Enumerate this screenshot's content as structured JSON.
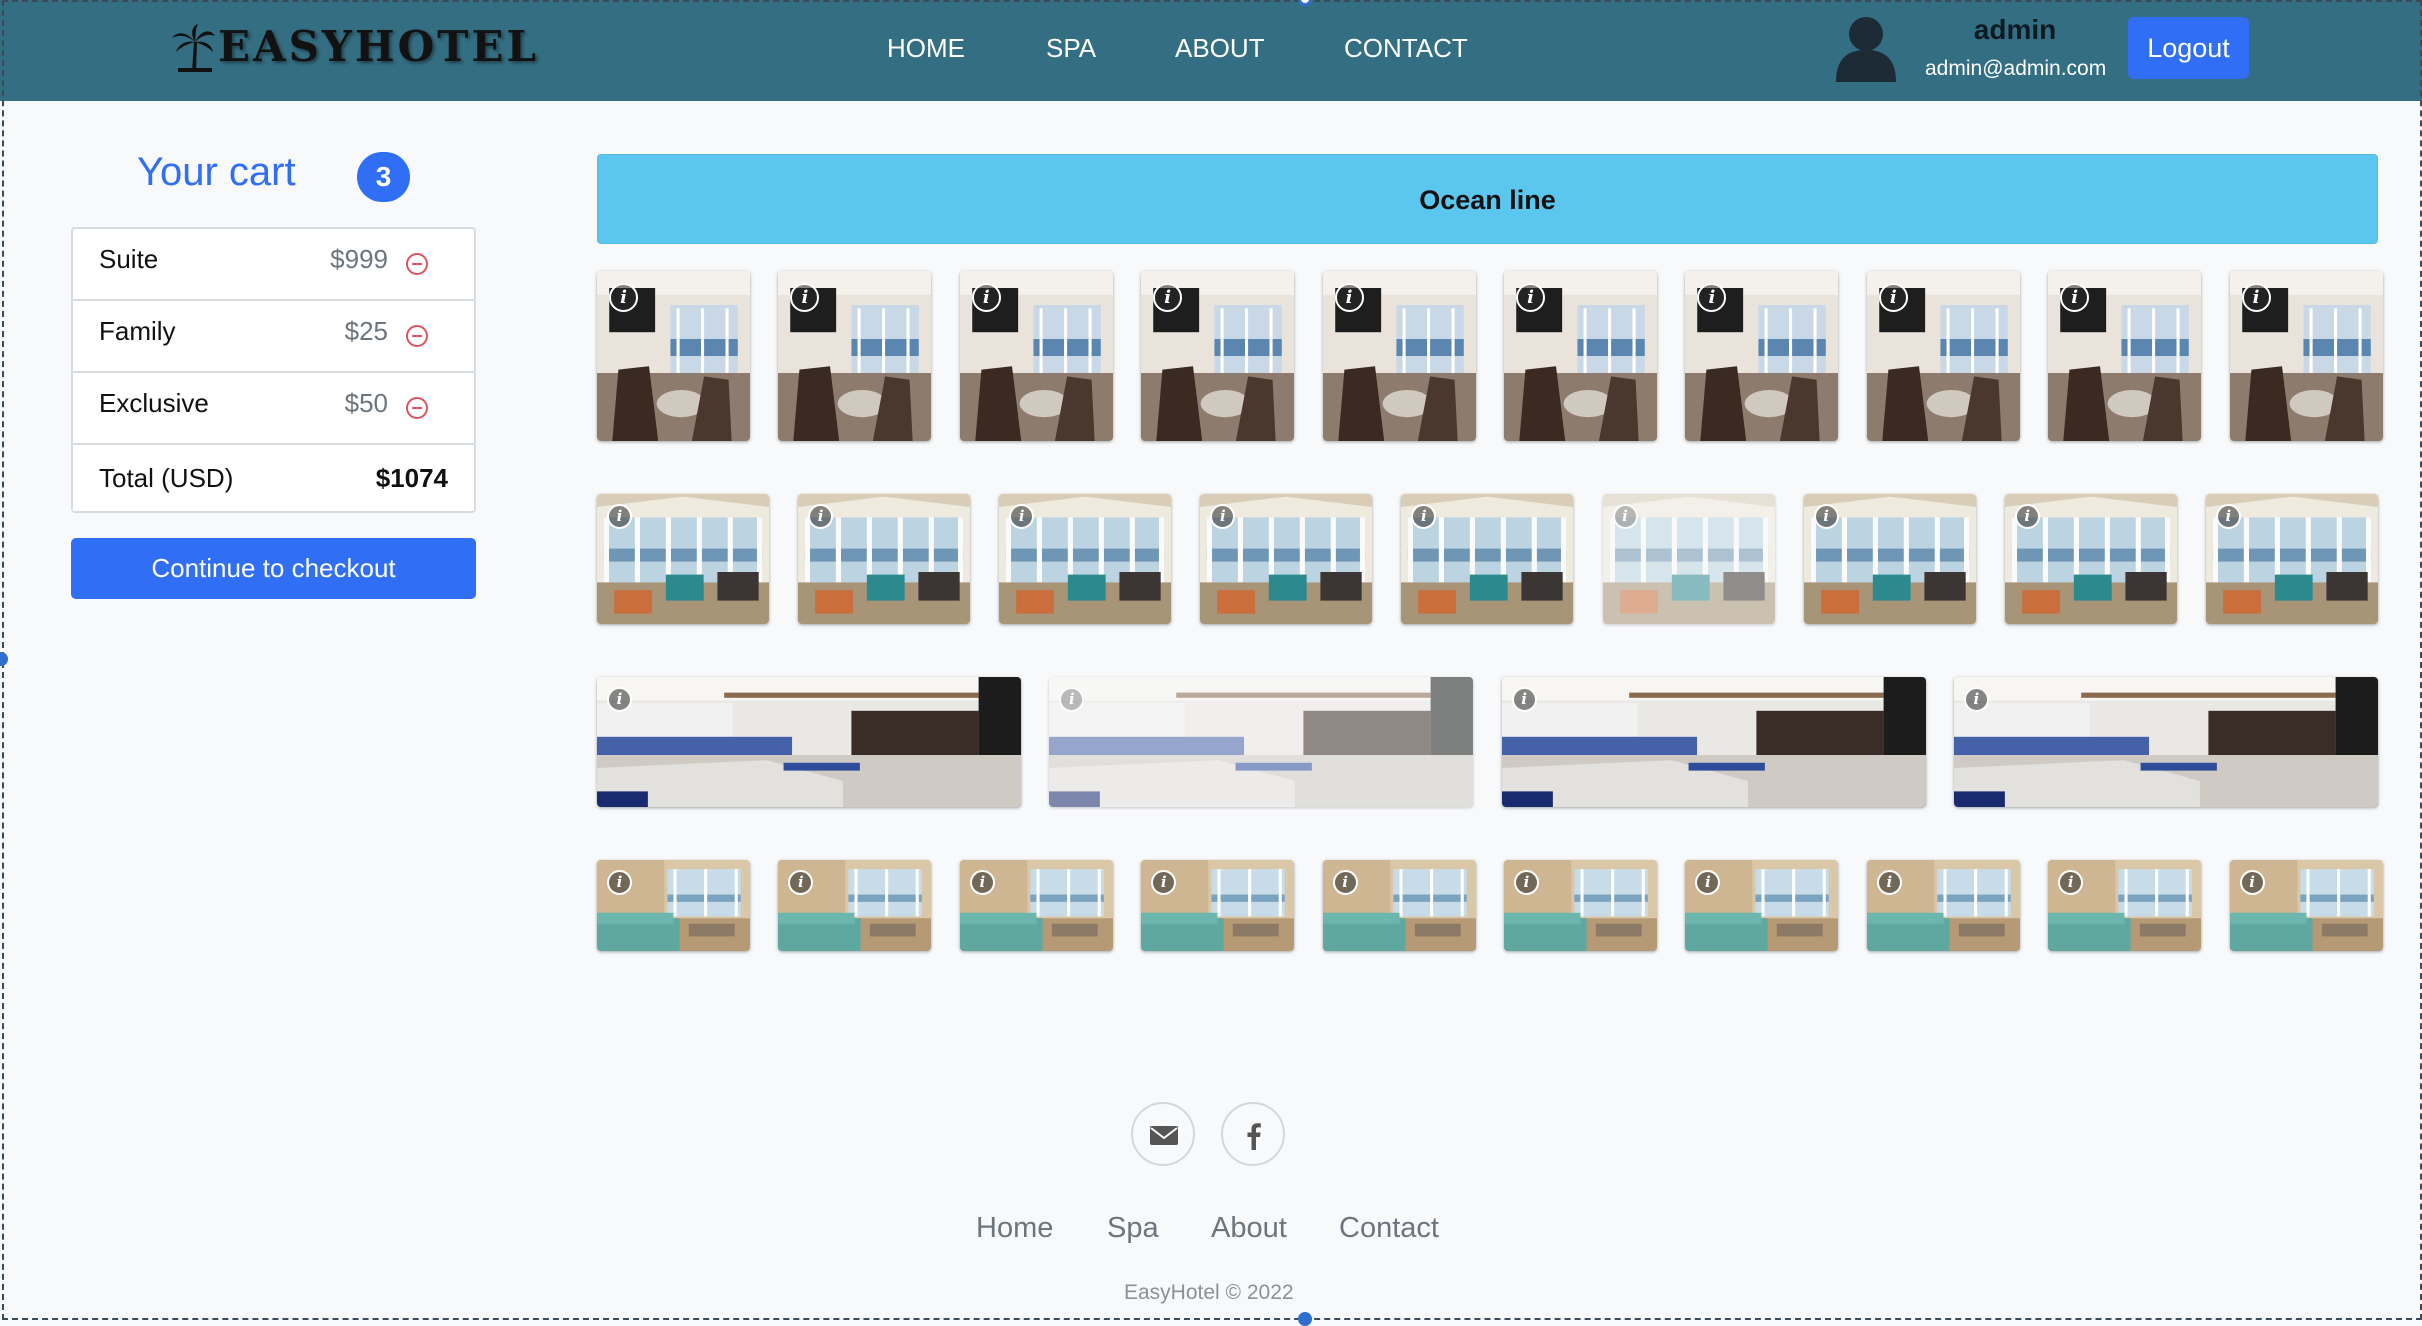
{
  "navbar": {
    "brand": "EasyHotel",
    "brand_icon": "palm-tree-icon",
    "links": [
      "HOME",
      "SPA",
      "ABOUT",
      "CONTACT"
    ],
    "user": {
      "name": "admin",
      "email": "admin@admin.com"
    },
    "logout_label": "Logout"
  },
  "cart": {
    "title": "Your cart",
    "count": "3",
    "items": [
      {
        "name": "Suite",
        "price": "$999"
      },
      {
        "name": "Family",
        "price": "$25"
      },
      {
        "name": "Exclusive",
        "price": "$50"
      }
    ],
    "total_label": "Total (USD)",
    "total_value": "$1074",
    "checkout_label": "Continue to checkout"
  },
  "gallery": {
    "title": "Ocean line",
    "info_glyph": "i",
    "rows": [
      {
        "scene": "living-room-tv",
        "count": 10
      },
      {
        "scene": "sunroom-windows",
        "count": 9
      },
      {
        "scene": "kitchen-lounge",
        "count": 4
      },
      {
        "scene": "teal-sofa-room",
        "count": 10
      }
    ]
  },
  "footer": {
    "social_icons": [
      "email-icon",
      "facebook-icon"
    ],
    "links": [
      "Home",
      "Spa",
      "About",
      "Contact"
    ],
    "copyright": "EasyHotel © 2022"
  },
  "colors": {
    "navbar": "#346e82",
    "primary": "#2f6ef5",
    "ocean_header": "#5cc7ee",
    "remove": "#e05260"
  }
}
